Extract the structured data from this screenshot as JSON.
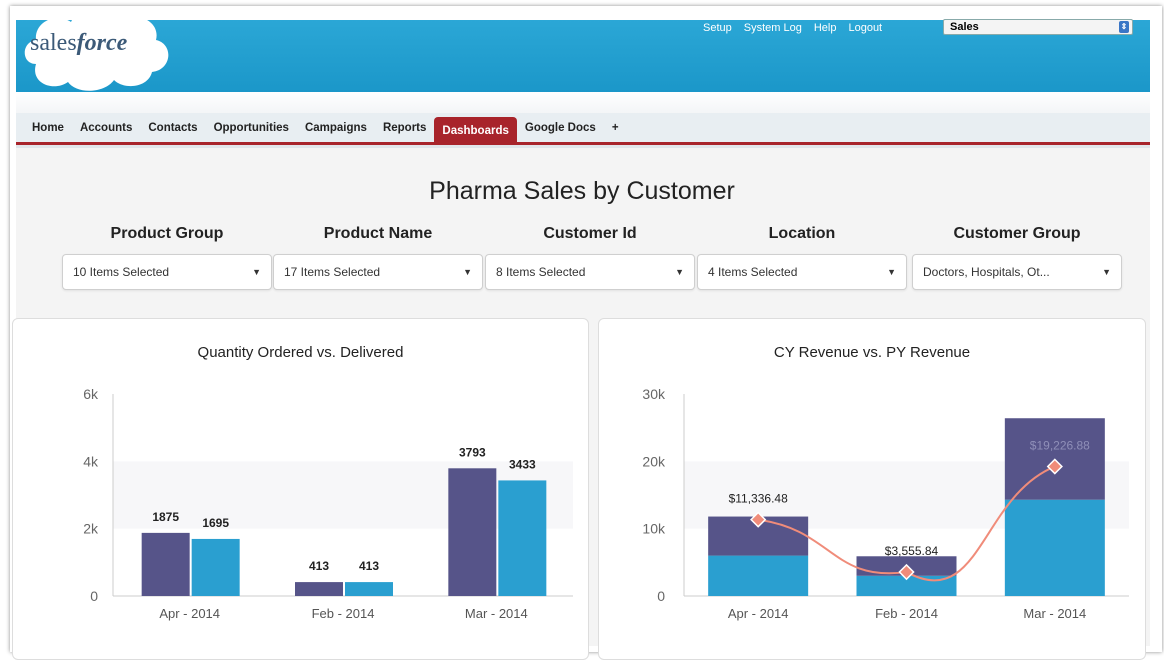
{
  "brand": "salesforce",
  "top_links": [
    "Setup",
    "System Log",
    "Help",
    "Logout"
  ],
  "app_selector": "Sales",
  "tabs": [
    "Home",
    "Accounts",
    "Contacts",
    "Opportunities",
    "Campaigns",
    "Reports",
    "Dashboards",
    "Google Docs",
    "+"
  ],
  "active_tab": "Dashboards",
  "dashboard_title": "Pharma Sales by Customer",
  "filters": [
    {
      "label": "Product Group",
      "value": "10 Items Selected"
    },
    {
      "label": "Product Name",
      "value": "17 Items Selected"
    },
    {
      "label": "Customer Id",
      "value": "8 Items Selected"
    },
    {
      "label": "Location",
      "value": "4 Items Selected"
    },
    {
      "label": "Customer Group",
      "value": "Doctors, Hospitals, Ot..."
    }
  ],
  "colors": {
    "header": "#1b97c9",
    "active_tab": "#a8242b",
    "series_purple": "#565489",
    "series_blue": "#2a9fd0",
    "line": "#f08c7a"
  },
  "chart_data": [
    {
      "type": "bar",
      "title": "Quantity Ordered vs. Delivered",
      "categories": [
        "Apr - 2014",
        "Feb - 2014",
        "Mar - 2014"
      ],
      "series": [
        {
          "values": [
            1875,
            413,
            3793
          ]
        },
        {
          "values": [
            1695,
            413,
            3433
          ]
        }
      ],
      "data_labels": [
        [
          "1875",
          "413",
          "3793"
        ],
        [
          "1695",
          "413",
          "3433"
        ]
      ],
      "yticks": [
        "0",
        "2k",
        "4k",
        "6k"
      ],
      "ylim": [
        0,
        6000
      ]
    },
    {
      "type": "bar",
      "stacked": true,
      "title": "CY Revenue vs. PY Revenue",
      "categories": [
        "Apr - 2014",
        "Feb - 2014",
        "Mar - 2014"
      ],
      "series": [
        {
          "values": [
            6000,
            3000,
            14300
          ]
        },
        {
          "values": [
            5800,
            2900,
            12100
          ]
        }
      ],
      "line": {
        "values": [
          11336.48,
          3555.84,
          19226.88
        ]
      },
      "data_labels": [
        "$11,336.48",
        "$3,555.84",
        "$19,226.88"
      ],
      "yticks": [
        "0",
        "10k",
        "20k",
        "30k"
      ],
      "ylim": [
        0,
        30000
      ]
    }
  ]
}
